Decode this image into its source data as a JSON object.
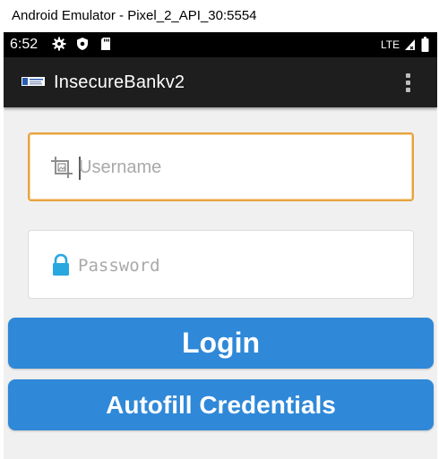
{
  "window": {
    "title": "Android Emulator - Pixel_2_API_30:5554"
  },
  "status_bar": {
    "time": "6:52",
    "network": "LTE",
    "icons": [
      "settings-gear-icon",
      "shield-icon",
      "sd-card-icon",
      "signal-icon",
      "battery-icon"
    ]
  },
  "app_bar": {
    "title": "InsecureBankv2",
    "menu_icon": "overflow-menu-icon"
  },
  "form": {
    "username": {
      "value": "",
      "placeholder": "Username",
      "icon": "crop-image-icon"
    },
    "password": {
      "value": "",
      "placeholder": "Password",
      "icon": "lock-icon"
    }
  },
  "buttons": {
    "login_label": "Login",
    "autofill_label": "Autofill Credentials"
  },
  "colors": {
    "app_bar": "#1e1e1e",
    "status_bar": "#000000",
    "content_bg": "#f0f0f0",
    "button": "#2f88d8",
    "focus_border": "#e8a33d",
    "lock_icon": "#29a8e0"
  }
}
